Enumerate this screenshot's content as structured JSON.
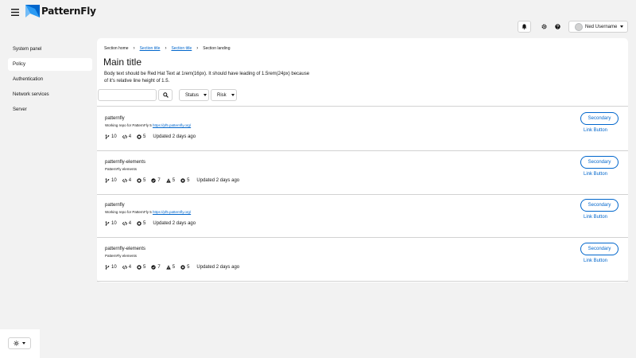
{
  "app": {
    "brand": "PatternFly"
  },
  "header": {
    "user_name": "Ned Username",
    "icons": [
      "hamburger-icon",
      "bell-icon",
      "gear-icon",
      "help-icon",
      "caret-down-icon"
    ]
  },
  "sidebar": {
    "items": [
      {
        "label": "System panel"
      },
      {
        "label": "Policy"
      },
      {
        "label": "Authentication"
      },
      {
        "label": "Network services"
      },
      {
        "label": "Server"
      }
    ],
    "active": "Policy"
  },
  "breadcrumb": {
    "items": [
      "Section home",
      "Section title",
      "Section title",
      "Section landing"
    ]
  },
  "page": {
    "title": "Main title",
    "description": "Body text should be Red Hat Text at 1rem(16px). It should have leading of 1.5rem(24px) because of it's relative line height of 1.5."
  },
  "toolbar": {
    "search_value": "",
    "status_label": "Status",
    "risk_label": "Risk"
  },
  "repos": [
    {
      "name": "patternfly",
      "desc_prefix": "Working repo for PatternFly 5 ",
      "desc_link": "https://pf5.patternfly.org/",
      "branches": "10",
      "commits": "4",
      "copies": "5",
      "updated": "Updated 2 days ago",
      "secondary": "Secondary",
      "link": "Link Button"
    },
    {
      "name": "patternfly-elements",
      "desc_text": "PatternFly elements",
      "branches": "10",
      "commits": "4",
      "copies": "5",
      "checks": "7",
      "warnings": "5",
      "errors": "5",
      "updated": "Updated 2 days ago",
      "secondary": "Secondary",
      "link": "Link Button"
    },
    {
      "name": "patternfly",
      "desc_prefix": "Working repo for PatternFly 5 ",
      "desc_link": "https://pf5.patternfly.org/",
      "branches": "10",
      "commits": "4",
      "copies": "5",
      "updated": "Updated 2 days ago",
      "secondary": "Secondary",
      "link": "Link Button"
    },
    {
      "name": "patternfly-elements",
      "desc_text": "PatternFly elements",
      "branches": "10",
      "commits": "4",
      "copies": "5",
      "checks": "7",
      "warnings": "5",
      "errors": "5",
      "updated": "Updated 2 days ago",
      "secondary": "Secondary",
      "link": "Link Button"
    }
  ],
  "colors": {
    "accent": "#0066cc",
    "background": "#f2f2f2",
    "border": "#d2d2d2"
  }
}
